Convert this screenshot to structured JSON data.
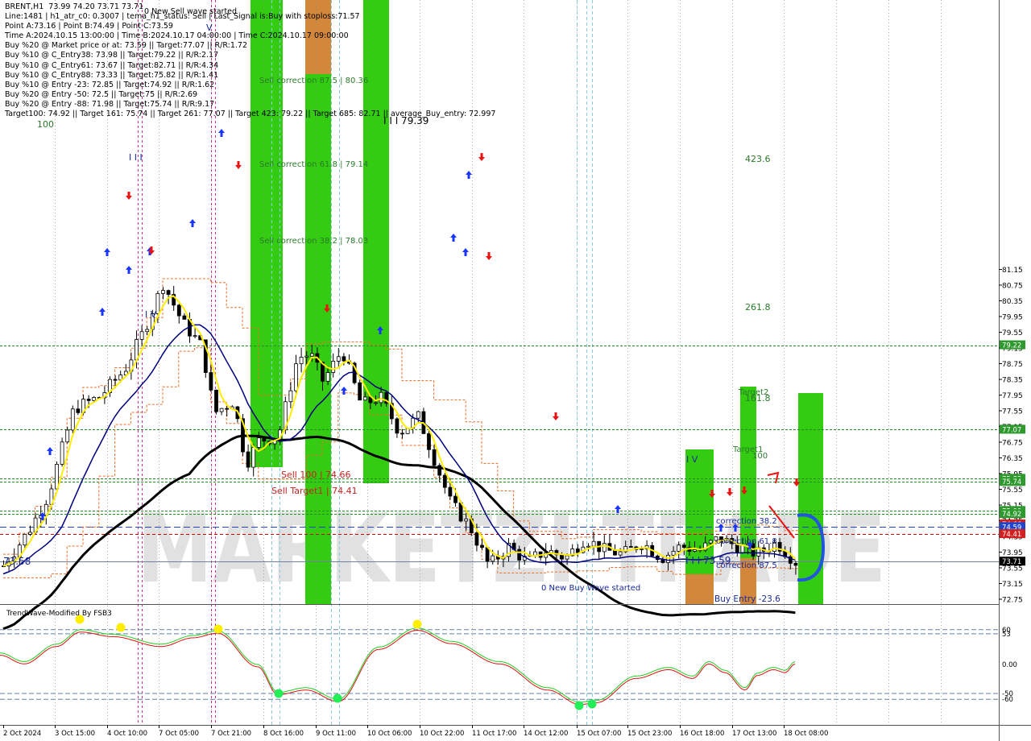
{
  "header": {
    "lines": [
      "BRENT,H1  73.99 74.20 73.71 73.71",
      "Line:1481 | h1_atr_c0: 0.3007 | tema_h1_status: Sell | Last_Signal is:Buy with stoploss:71.57",
      "Point A:73.16 | Point B:74.49 | Point C:73.59",
      "Time A:2024.10.15 13:00:00 | Time B:2024.10.17 04:00:00 | Time C:2024.10.17 09:00:00",
      "Buy %20 @ Market price or at: 73.59 || Target:77.07 || R/R:1.72",
      "Buy %10 @ C_Entry38: 73.98 || Target:79.22 || R/R:2.17",
      "Buy %10 @ C_Entry61: 73.67 || Target:82.71 || R/R:4.34",
      "Buy %10 @ C_Entry88: 73.33 || Target:75.82 || R/R:1.41",
      "Buy %10 @ Entry -23: 72.85 || Target:74.92 || R/R:1.62",
      "Buy %20 @ Entry -50: 72.5 || Target:75 || R/R:2.69",
      "Buy %20 @ Entry -88: 71.98 || Target:75.74 || R/R:9.17",
      "Target100: 74.92 || Target 161: 75.74 || Target 261: 77.07 || Target 423: 79.22 || Target 685: 82.71 || average_Buy_entry: 72.997"
    ]
  },
  "colors": {
    "green_zone": "#33cc11",
    "orange_zone": "#d2873a",
    "fast_ma": "#ffee00",
    "mid_ma": "#000080",
    "slow_ma": "#000000",
    "level_line": "#228b22",
    "sell_line": "#cc0000",
    "blue_dash": "#2244cc",
    "up_candle": "#000000",
    "down_candle": "#000000",
    "arrow_up": "#1a35ff",
    "arrow_down": "#ee1111",
    "osc_green": "#22cc22",
    "osc_red": "#dd1111",
    "osc_dot_yellow": "#ffee00",
    "osc_dot_green": "#22ee55",
    "watermark": "#c8c8c8"
  },
  "chart_data": {
    "type": "candlestick",
    "symbol": "BRENT",
    "timeframe": "H1",
    "ylim": [
      72.65,
      81.25
    ],
    "y_ticks": [
      "81.15",
      "80.75",
      "80.35",
      "79.95",
      "79.55",
      "79.15",
      "78.75",
      "78.35",
      "77.95",
      "77.55",
      "77.15",
      "76.75",
      "76.35",
      "75.95",
      "75.55",
      "75.15",
      "74.75",
      "74.35",
      "73.95",
      "73.55",
      "73.15",
      "72.75"
    ],
    "x_ticks": [
      "2 Oct 2024",
      "3 Oct 15:00",
      "4 Oct 10:00",
      "7 Oct 05:00",
      "7 Oct 21:00",
      "8 Oct 16:00",
      "9 Oct 11:00",
      "10 Oct 06:00",
      "10 Oct 22:00",
      "11 Oct 17:00",
      "14 Oct 12:00",
      "15 Oct 07:00",
      "15 Oct 23:00",
      "16 Oct 18:00",
      "17 Oct 13:00",
      "18 Oct 08:00"
    ],
    "price_tags": [
      {
        "value": 79.22,
        "label": "79.22",
        "color": "#2e9a2e"
      },
      {
        "value": 77.07,
        "label": "77.07",
        "color": "#2e9a2e"
      },
      {
        "value": 75.82,
        "label": "75.82",
        "color": "#2e9a2e"
      },
      {
        "value": 75.74,
        "label": "75.74",
        "color": "#2e9a2e"
      },
      {
        "value": 75.0,
        "label": "75.00",
        "color": "#2e9a2e"
      },
      {
        "value": 74.92,
        "label": "74.92",
        "color": "#2e9a2e"
      },
      {
        "value": 74.66,
        "label": "74.66",
        "color": "#d22020"
      },
      {
        "value": 74.59,
        "label": "74.59",
        "color": "#2244cc"
      },
      {
        "value": 74.41,
        "label": "74.41",
        "color": "#d22020"
      },
      {
        "value": 73.71,
        "label": "73.71",
        "color": "#000000"
      }
    ],
    "levels": [
      {
        "value": 79.22,
        "style": "green-dotted"
      },
      {
        "value": 77.07,
        "style": "green-dotted"
      },
      {
        "value": 75.82,
        "style": "green-dotted"
      },
      {
        "value": 75.74,
        "style": "green-dotted"
      },
      {
        "value": 75.0,
        "style": "green-dotted"
      },
      {
        "value": 74.92,
        "style": "green-dotted"
      },
      {
        "value": 74.59,
        "style": "blue-dashed"
      },
      {
        "value": 74.41,
        "style": "red-dashed"
      },
      {
        "value": 73.71,
        "style": "gray-solid"
      }
    ],
    "annotations": [
      {
        "text": "0 New Sell wave started",
        "color": "#000000"
      },
      {
        "text": "Sell correction 87.5 | 80.36",
        "color": "#2a7a2a"
      },
      {
        "text": "Sell correction 61.8 | 79.14",
        "color": "#2a7a2a"
      },
      {
        "text": "Sell correction 38.2 | 78.03",
        "color": "#2a7a2a"
      },
      {
        "text": "I I I 79.39",
        "color": "#000000"
      },
      {
        "text": "423.6",
        "color": "#2a7a2a"
      },
      {
        "text": "261.8",
        "color": "#2a7a2a"
      },
      {
        "text": "Target2",
        "color": "#2a7a2a"
      },
      {
        "text": "161.8",
        "color": "#2a7a2a"
      },
      {
        "text": "Target1",
        "color": "#2a7a2a"
      },
      {
        "text": "100",
        "color": "#2a7a2a"
      },
      {
        "text": "Sell 100 | 74.66",
        "color": "#cc2020"
      },
      {
        "text": "Sell Target1 | 74.41",
        "color": "#cc2020"
      },
      {
        "text": "0 New Buy Wave started",
        "color": "#1a2a9a"
      },
      {
        "text": "I I I 73.59",
        "color": "#1a2a9a"
      },
      {
        "text": "correction 38.2",
        "color": "#1a2a9a"
      },
      {
        "text": "correction 61.8",
        "color": "#1a2a9a"
      },
      {
        "text": "correction 87.5",
        "color": "#1a2a9a"
      },
      {
        "text": "Buy Entry -23.6",
        "color": "#1a2a9a"
      },
      {
        "text": "I V",
        "color": "#1a2a9a"
      },
      {
        "text": "I I I",
        "color": "#1a2a9a"
      },
      {
        "text": "I V",
        "color": "#1a2a9a"
      },
      {
        "text": "V",
        "color": "#1a2a9a"
      },
      {
        "text": "73.58",
        "color": "#1a2a9a"
      },
      {
        "text": "100",
        "color": "#2a7a2a"
      }
    ],
    "series": [
      {
        "name": "fast",
        "kind": "moving-average"
      },
      {
        "name": "mid",
        "kind": "moving-average"
      },
      {
        "name": "slow",
        "kind": "moving-average"
      }
    ]
  },
  "oscillator": {
    "title": "TrendWave-Modified By FSB3",
    "ylim": [
      -100,
      100
    ],
    "y_ticks": [
      "60",
      "53",
      "0.00",
      "-50",
      "-60"
    ]
  },
  "watermark": {
    "text": "MARKETZI TRADE"
  }
}
